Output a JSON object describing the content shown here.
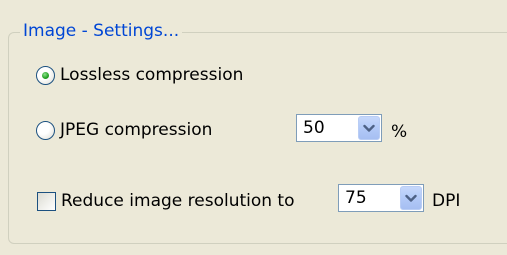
{
  "group": {
    "title": "Image - Settings..."
  },
  "options": {
    "lossless": {
      "label": "Lossless compression",
      "selected": true
    },
    "jpeg": {
      "label": "JPEG compression",
      "selected": false,
      "quality_value": "50",
      "unit": "%"
    },
    "reduce_resolution": {
      "label": "Reduce image resolution to",
      "checked": false,
      "dpi_value": "75",
      "unit": "DPI"
    }
  },
  "icons": {
    "dropdown": "chevron-down-icon"
  },
  "colors": {
    "panel_background": "#ece9d8",
    "group_title": "#0046d5",
    "control_border": "#1c5180",
    "radio_dot": "#21a121",
    "combo_border": "#7f9db9",
    "dropdown_button": "#b4cbf8",
    "chevron": "#4d6185"
  }
}
